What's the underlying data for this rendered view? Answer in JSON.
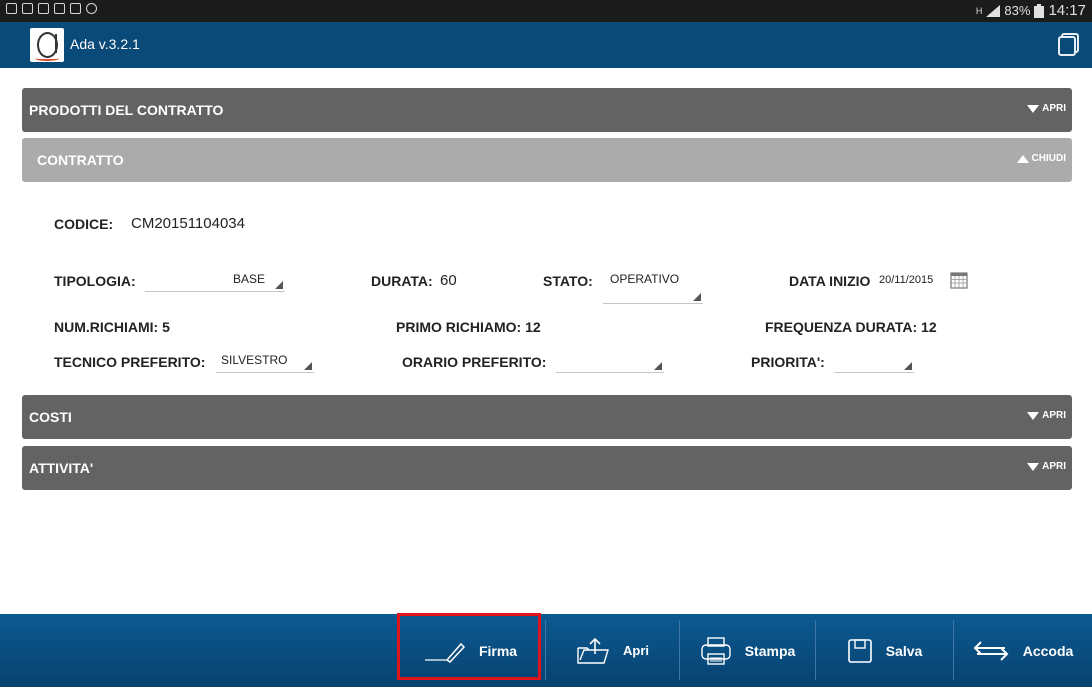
{
  "status_bar": {
    "battery": "83%",
    "time": "14:17",
    "signal_label": "H"
  },
  "app": {
    "title": "Ada v.3.2.1"
  },
  "sections": {
    "prodotti": {
      "title": "PRODOTTI DEL CONTRATTO",
      "toggle": "APRI"
    },
    "contratto": {
      "title": "CONTRATTO",
      "toggle": "CHIUDI"
    },
    "costi": {
      "title": "COSTI",
      "toggle": "APRI"
    },
    "attivita": {
      "title": "ATTIVITA'",
      "toggle": "APRI"
    }
  },
  "contract": {
    "codice_label": "CODICE:",
    "codice_value": "CM20151104034",
    "tipologia_label": "TIPOLOGIA:",
    "tipologia_value": "BASE",
    "durata_label": "DURATA:",
    "durata_value": "60",
    "stato_label": "STATO:",
    "stato_value": "OPERATIVO",
    "data_inizio_label": "DATA INIZIO",
    "data_inizio_value": "20/11/2015",
    "num_richiami": "NUM.RICHIAMI: 5",
    "primo_richiamo": "PRIMO RICHIAMO: 12",
    "frequenza_durata": "FREQUENZA DURATA: 12",
    "tecnico_label": "TECNICO PREFERITO:",
    "tecnico_value": "SILVESTRO",
    "orario_label": "ORARIO PREFERITO:",
    "orario_value": "",
    "priorita_label": "PRIORITA':",
    "priorita_value": ""
  },
  "toolbar": {
    "firma": "Firma",
    "apri": "Apri",
    "stampa": "Stampa",
    "salva": "Salva",
    "accoda": "Accoda"
  },
  "colors": {
    "app_bar": "#0a4a78",
    "section_dark": "#636363",
    "section_light": "#ababab",
    "highlight": "#e0141c"
  }
}
